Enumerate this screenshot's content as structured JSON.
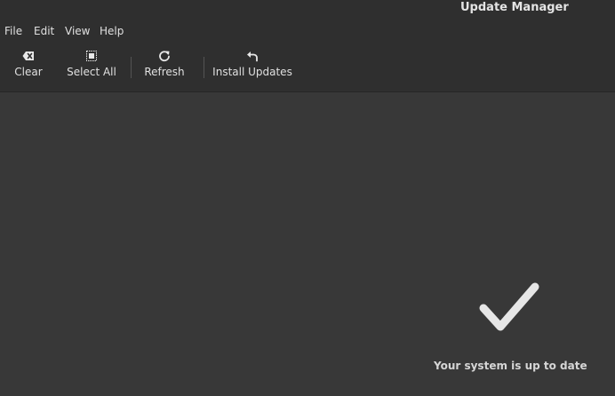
{
  "window": {
    "title": "Update Manager"
  },
  "menubar": {
    "items": [
      "File",
      "Edit",
      "View",
      "Help"
    ]
  },
  "toolbar": {
    "clear": {
      "label": "Clear",
      "icon": "backspace-clear-icon"
    },
    "select_all": {
      "label": "Select All",
      "icon": "select-all-icon"
    },
    "refresh": {
      "label": "Refresh",
      "icon": "refresh-icon"
    },
    "install_updates": {
      "label": "Install Updates",
      "icon": "install-updates-icon"
    }
  },
  "status": {
    "icon": "checkmark-icon",
    "message": "Your system is up to date"
  },
  "colors": {
    "background": "#383838",
    "chrome": "#2f2f2f",
    "text": "#e0e0e0",
    "check": "#e6e6e6"
  }
}
